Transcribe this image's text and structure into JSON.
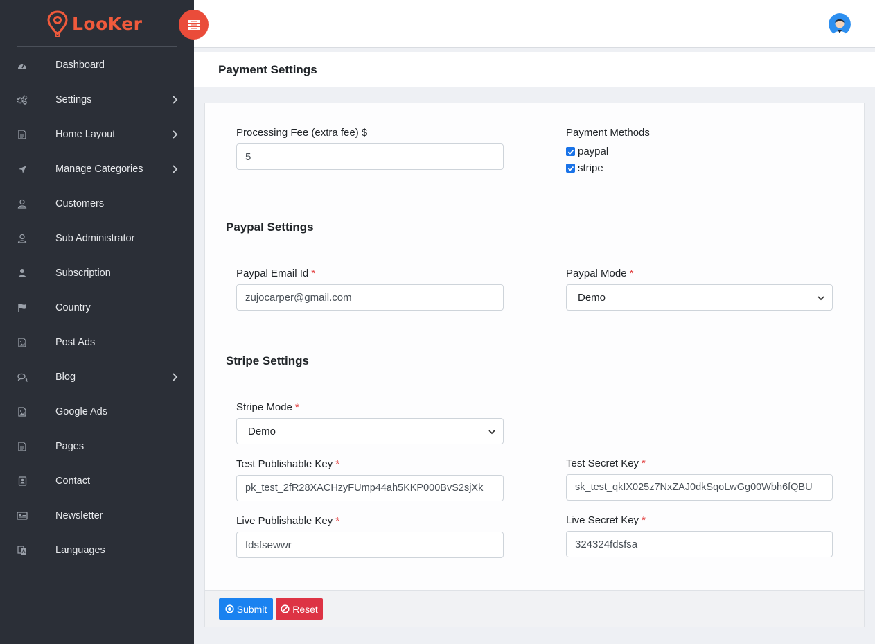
{
  "app": {
    "logo_text": "LooKer",
    "page_title": "Payment Settings"
  },
  "sidebar": {
    "items": [
      {
        "label": "Dashboard",
        "icon": "dashboard-icon",
        "has_children": false
      },
      {
        "label": "Settings",
        "icon": "gears-icon",
        "has_children": true
      },
      {
        "label": "Home Layout",
        "icon": "file-icon",
        "has_children": true
      },
      {
        "label": "Manage Categories",
        "icon": "location-arrow-icon",
        "has_children": true
      },
      {
        "label": "Customers",
        "icon": "user-outline-icon",
        "has_children": false
      },
      {
        "label": "Sub Administrator",
        "icon": "user-outline-icon",
        "has_children": false
      },
      {
        "label": "Subscription",
        "icon": "user-solid-icon",
        "has_children": false
      },
      {
        "label": "Country",
        "icon": "flag-icon",
        "has_children": false
      },
      {
        "label": "Post Ads",
        "icon": "image-file-icon",
        "has_children": false
      },
      {
        "label": "Blog",
        "icon": "comments-icon",
        "has_children": true
      },
      {
        "label": "Google Ads",
        "icon": "image-file-icon",
        "has_children": false
      },
      {
        "label": "Pages",
        "icon": "file-icon",
        "has_children": false
      },
      {
        "label": "Contact",
        "icon": "address-book-icon",
        "has_children": false
      },
      {
        "label": "Newsletter",
        "icon": "newspaper-icon",
        "has_children": false
      },
      {
        "label": "Languages",
        "icon": "language-icon",
        "has_children": false
      }
    ]
  },
  "form": {
    "processing_fee": {
      "label": "Processing Fee (extra fee) $",
      "value": "5"
    },
    "payment_methods": {
      "label": "Payment Methods",
      "options": [
        {
          "label": "paypal",
          "checked": true
        },
        {
          "label": "stripe",
          "checked": true
        }
      ]
    },
    "paypal_section_title": "Paypal Settings",
    "paypal_email": {
      "label": "Paypal Email Id",
      "value": "zujocarper@gmail.com",
      "required_mark": "*"
    },
    "paypal_mode": {
      "label": "Paypal Mode",
      "value": "Demo",
      "required_mark": "*"
    },
    "stripe_section_title": "Stripe Settings",
    "stripe_mode": {
      "label": "Stripe Mode",
      "value": "Demo",
      "required_mark": "*"
    },
    "test_publishable_key": {
      "label": "Test Publishable Key",
      "value": "pk_test_2fR28XACHzyFUmp44ah5KKP000BvS2sjXk",
      "required_mark": "*"
    },
    "test_secret_key": {
      "label": "Test Secret Key",
      "value": "sk_test_qkIX025z7NxZAJ0dkSqoLwGg00Wbh6fQBU",
      "required_mark": "*"
    },
    "live_publishable_key": {
      "label": "Live Publishable Key",
      "value": "fdsfsewwr",
      "required_mark": "*"
    },
    "live_secret_key": {
      "label": "Live Secret Key",
      "value": "324324fdsfsa",
      "required_mark": "*"
    }
  },
  "buttons": {
    "submit": "Submit",
    "reset": "Reset"
  },
  "colors": {
    "sidebar_bg": "#2b2f37",
    "brand": "#f05a3c",
    "submit": "#1a82f0",
    "reset": "#dd3344",
    "required": "#e23d3d"
  }
}
